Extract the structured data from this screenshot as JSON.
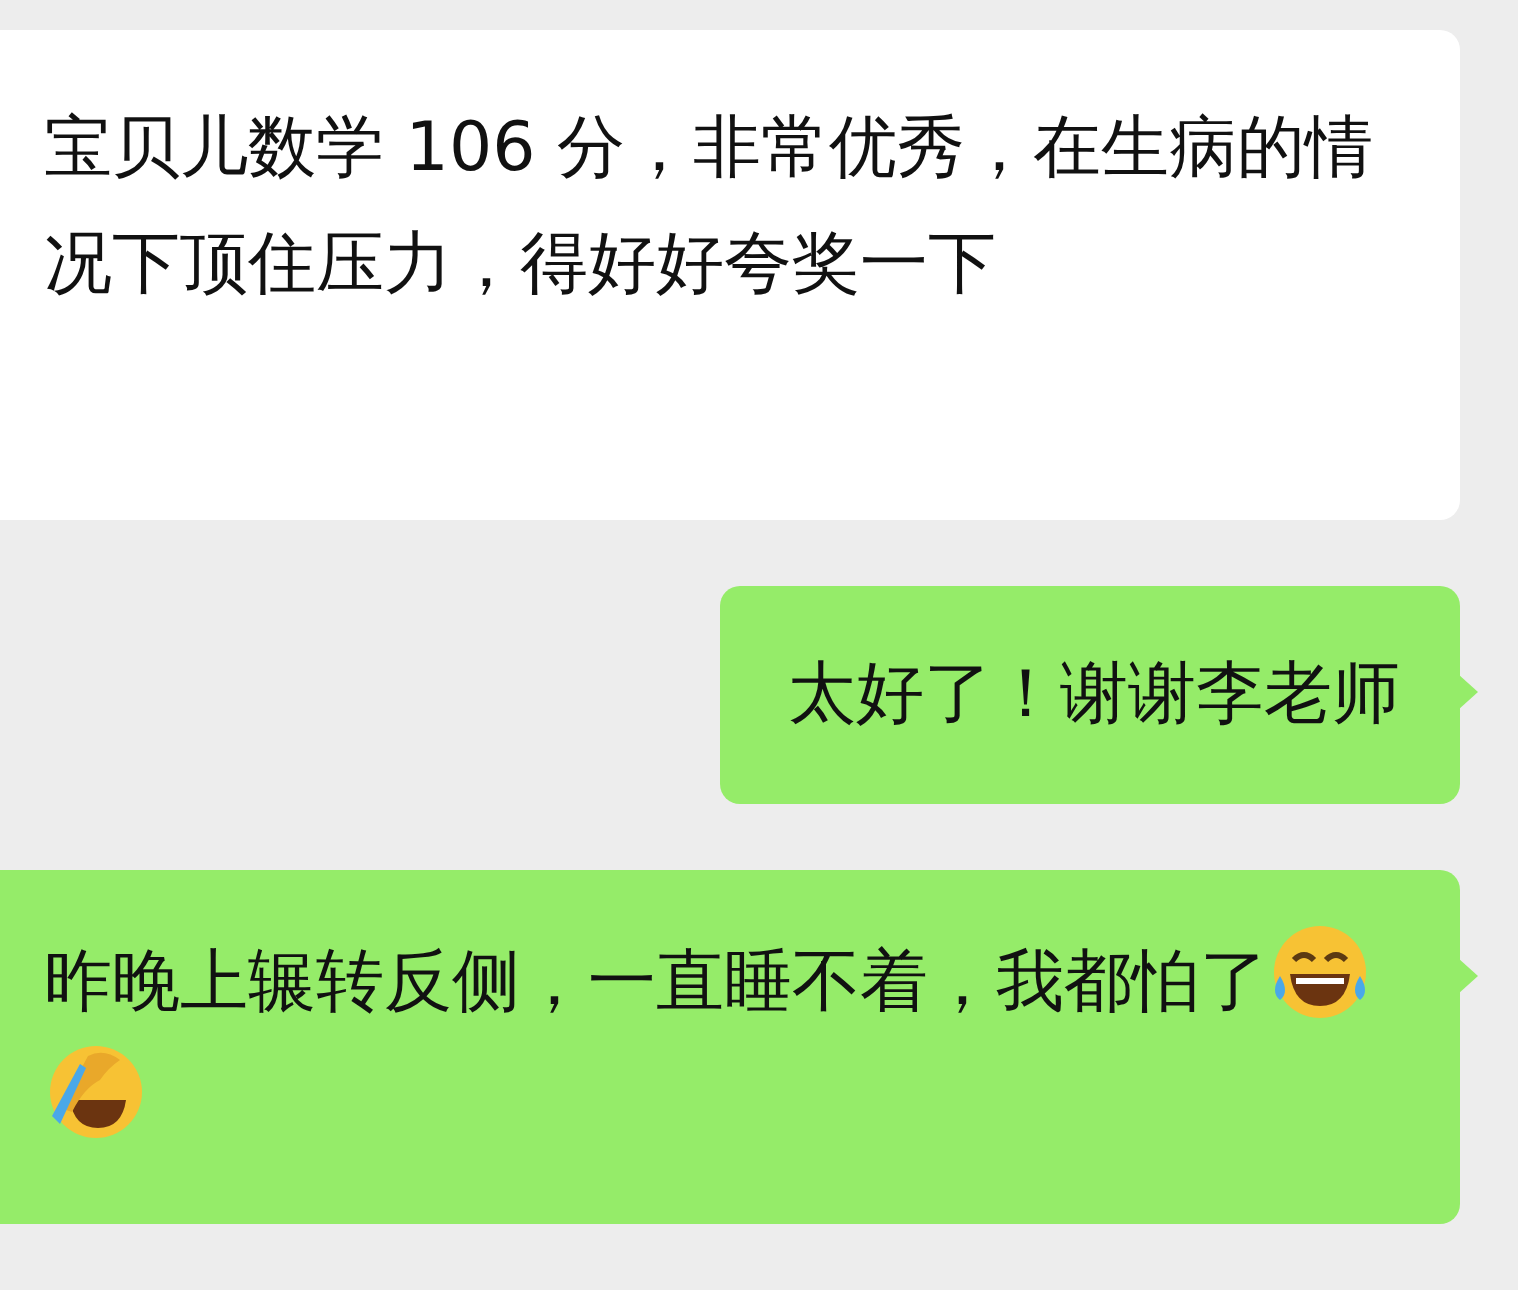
{
  "messages": [
    {
      "kind": "received",
      "text": "宝贝儿数学 106 分，非常优秀，在生病的情况下顶住压力，得好好夸奖一下"
    },
    {
      "kind": "sent",
      "text": "太好了！谢谢李老师"
    },
    {
      "kind": "sent",
      "text": "昨晚上辗转反侧，一直睡不着，我都怕了",
      "emojis": [
        {
          "kind": "laugh"
        },
        {
          "kind": "facepalm"
        }
      ]
    }
  ]
}
